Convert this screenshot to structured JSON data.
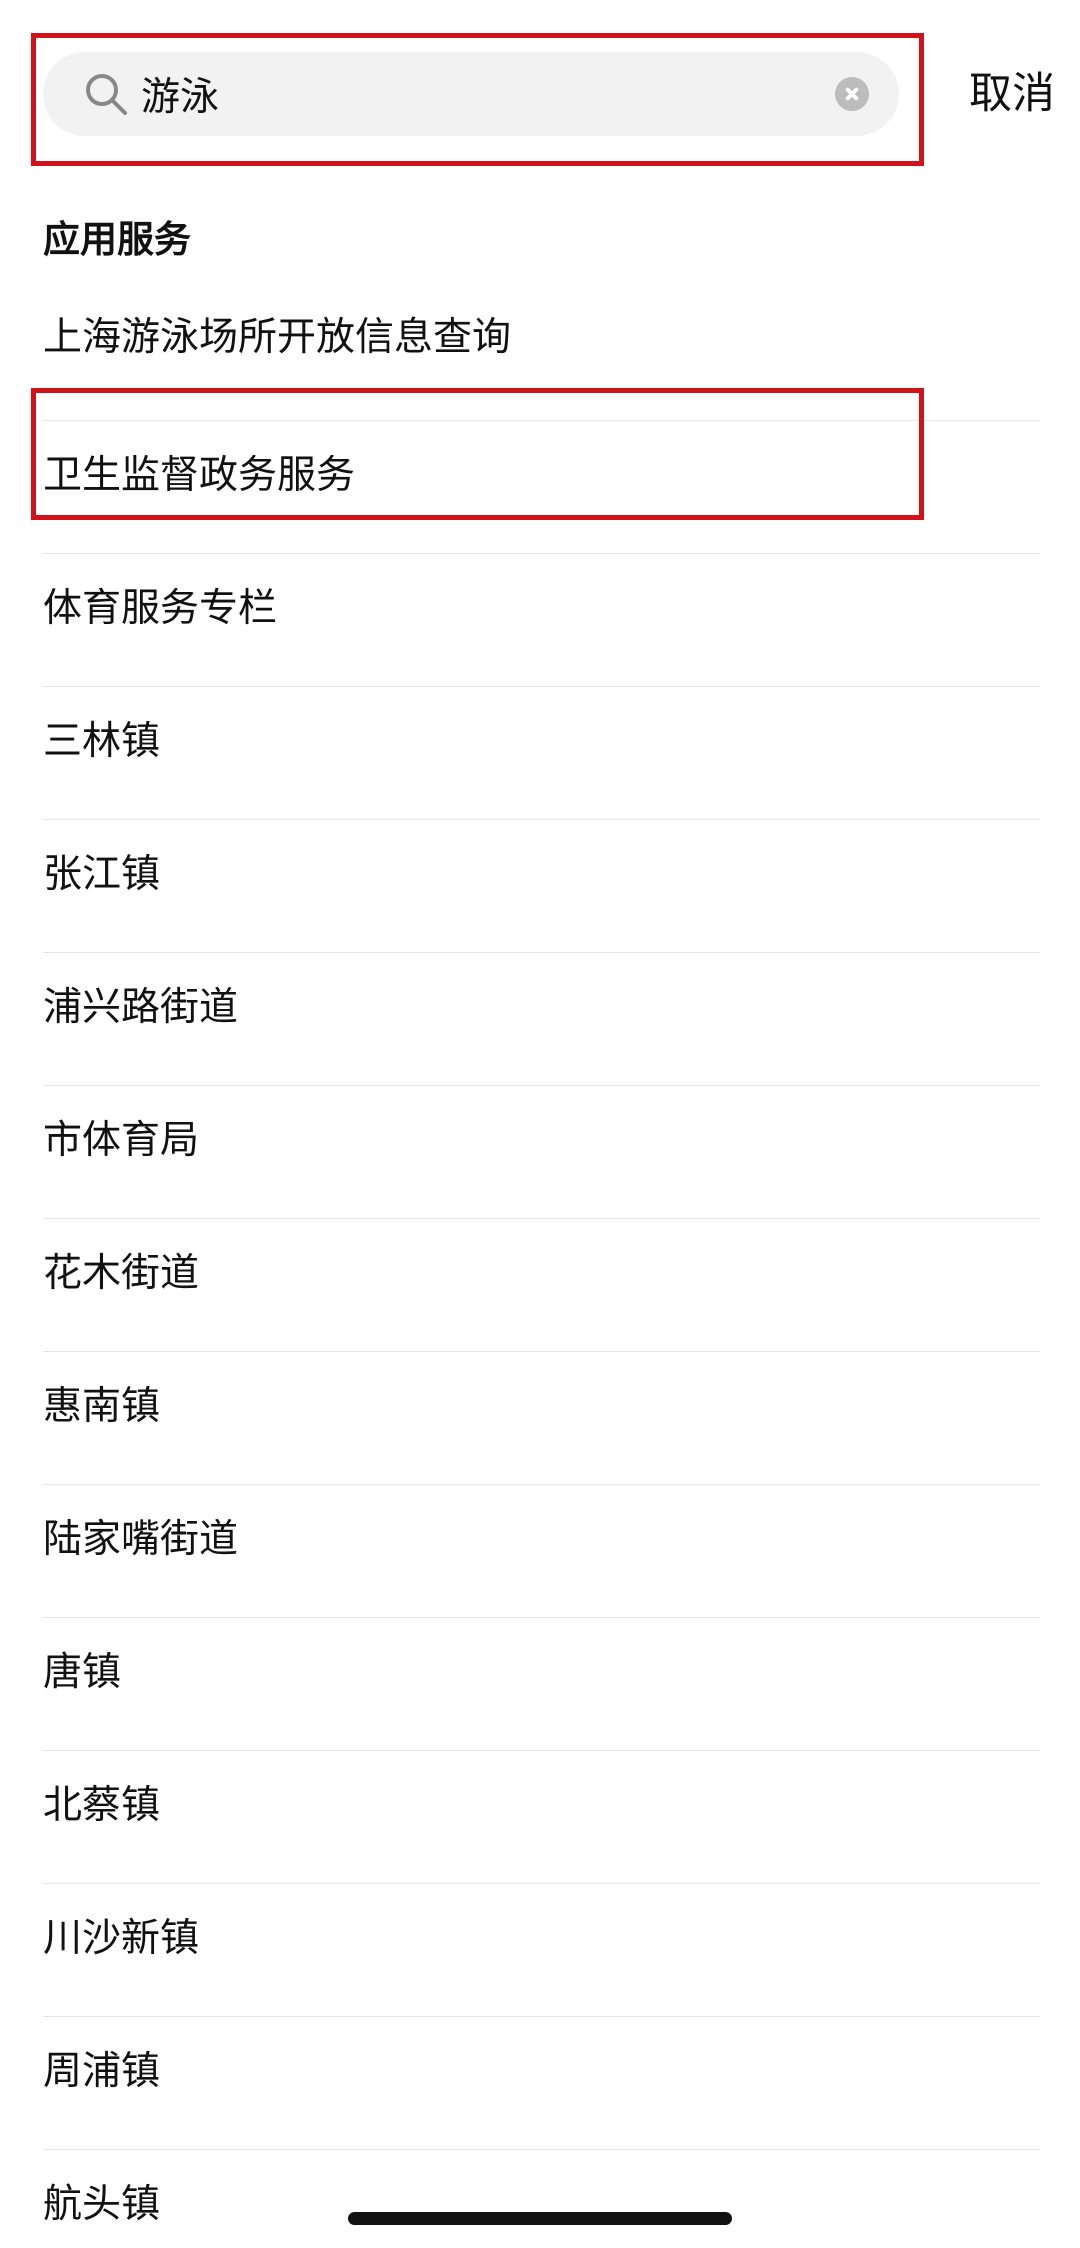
{
  "search": {
    "value": "游泳",
    "cancel_label": "取消"
  },
  "section": {
    "title": "应用服务"
  },
  "results": [
    "上海游泳场所开放信息查询",
    "卫生监督政务服务",
    "体育服务专栏",
    "三林镇",
    "张江镇",
    "浦兴路街道",
    "市体育局",
    "花木街道",
    "惠南镇",
    "陆家嘴街道",
    "唐镇",
    "北蔡镇",
    "川沙新镇",
    "周浦镇",
    "航头镇"
  ],
  "colors": {
    "highlight": "#d0121b",
    "search_bg": "#f2f2f2",
    "divider": "#e6e6e6"
  }
}
